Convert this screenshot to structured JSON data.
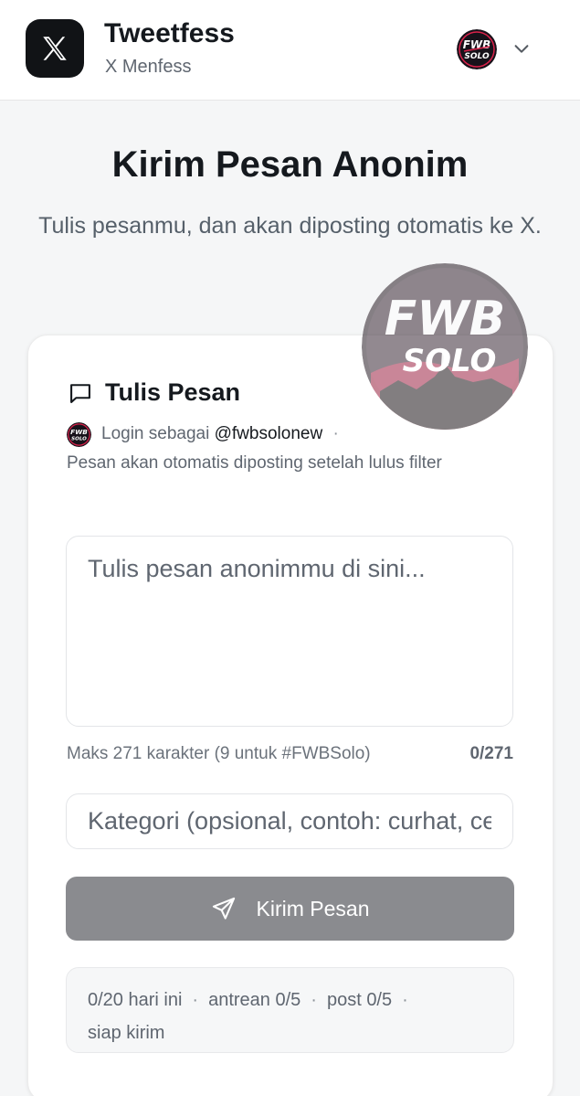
{
  "header": {
    "app_name": "Tweetfess",
    "app_subtitle": "X Menfess"
  },
  "hero": {
    "title": "Kirim Pesan Anonim",
    "subtitle": "Tulis pesanmu, dan akan diposting otomatis ke X."
  },
  "card": {
    "title": "Tulis Pesan",
    "login_prefix": "Login sebagai",
    "username": "@fwbsolonew",
    "separator": "·",
    "info": "Pesan akan otomatis diposting setelah lulus filter",
    "message_placeholder": "Tulis pesan anonimmu di sini...",
    "limit_hint": "Maks 271 karakter (9 untuk #FWBSolo)",
    "char_counter": "0/271",
    "category_placeholder": "Kategori (opsional, contoh: curhat, cerita)",
    "send_label": "Kirim Pesan"
  },
  "stats": {
    "today": "0/20 hari ini",
    "queue": "antrean 0/5",
    "post": "post 0/5",
    "status": "siap kirim",
    "dot": "·"
  },
  "logo": {
    "brand_top": "FWB",
    "brand_bottom": "SOLO"
  },
  "colors": {
    "send_button": "#8a8b8f",
    "logo_bg": "#111316",
    "brand_red": "#d9224a"
  }
}
